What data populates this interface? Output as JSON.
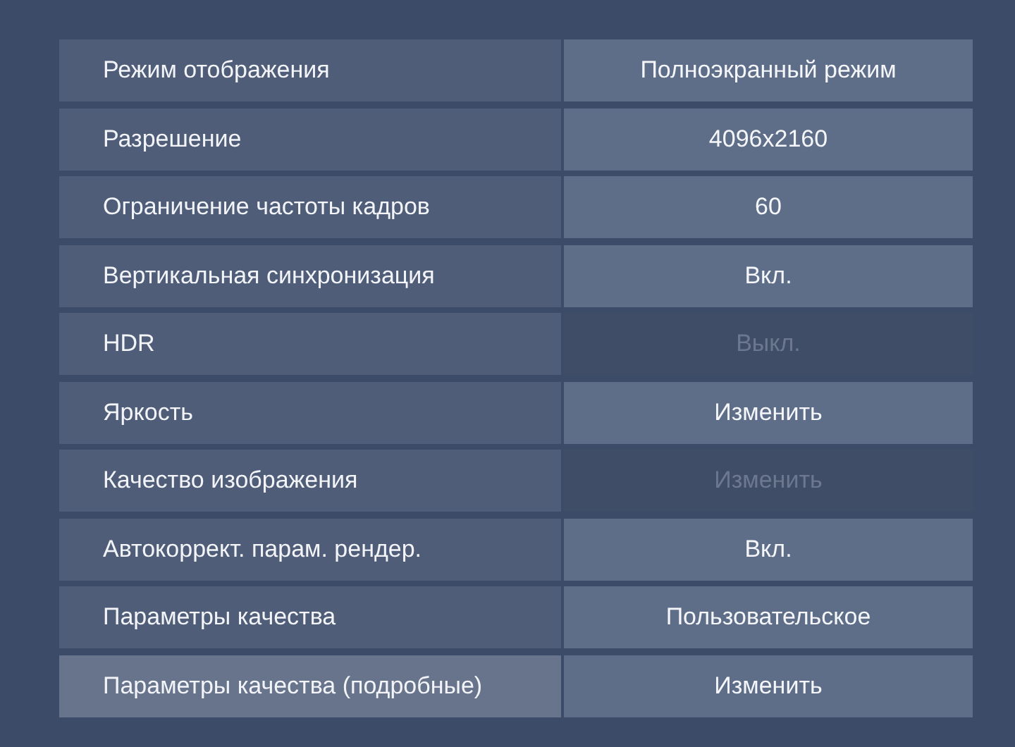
{
  "settings": [
    {
      "label": "Режим отображения",
      "value": "Полноэкранный режим",
      "disabled": false,
      "selected": false
    },
    {
      "label": "Разрешение",
      "value": "4096x2160",
      "disabled": false,
      "selected": false
    },
    {
      "label": "Ограничение частоты кадров",
      "value": "60",
      "disabled": false,
      "selected": false
    },
    {
      "label": "Вертикальная синхронизация",
      "value": "Вкл.",
      "disabled": false,
      "selected": false
    },
    {
      "label": "HDR",
      "value": "Выкл.",
      "disabled": true,
      "selected": false
    },
    {
      "label": "Яркость",
      "value": "Изменить",
      "disabled": false,
      "selected": false
    },
    {
      "label": "Качество изображения",
      "value": "Изменить",
      "disabled": true,
      "selected": false
    },
    {
      "label": "Автокоррект. парам. рендер.",
      "value": "Вкл.",
      "disabled": false,
      "selected": false
    },
    {
      "label": "Параметры качества",
      "value": "Пользовательское",
      "disabled": false,
      "selected": false
    },
    {
      "label": "Параметры качества (подробные)",
      "value": "Изменить",
      "disabled": false,
      "selected": true
    }
  ]
}
